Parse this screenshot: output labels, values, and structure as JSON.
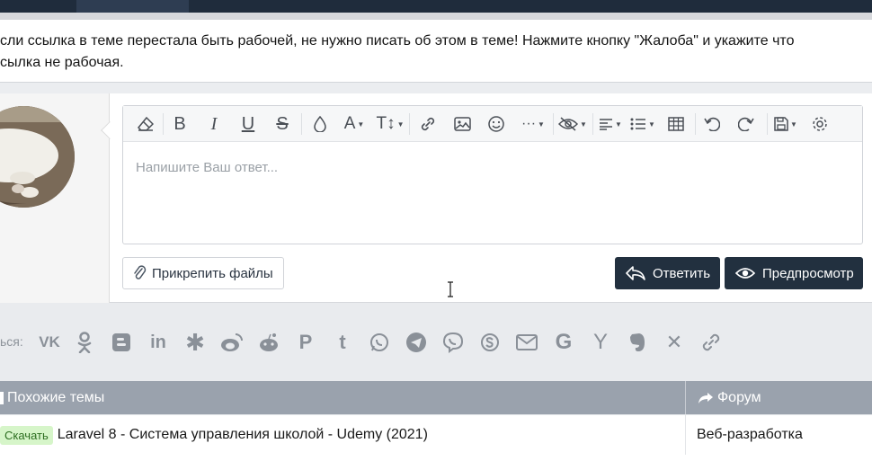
{
  "notice": {
    "text_line1": "сли ссылка в теме перестала быть рабочей, не нужно писать об этом в теме! Нажмите кнопку \"Жалоба\" и укажите что",
    "text_line2": "сылка не рабочая."
  },
  "editor": {
    "placeholder": "Напишите Ваш ответ...",
    "toolbar": [
      {
        "name": "eraser-icon"
      },
      {
        "name": "bold-icon"
      },
      {
        "name": "italic-icon"
      },
      {
        "name": "underline-icon"
      },
      {
        "name": "strike-icon"
      },
      {
        "name": "color-icon"
      },
      {
        "name": "font-family-icon"
      },
      {
        "name": "font-size-icon"
      },
      {
        "name": "link-icon"
      },
      {
        "name": "image-icon"
      },
      {
        "name": "smile-icon"
      },
      {
        "name": "more-icon"
      },
      {
        "name": "hide-icon"
      },
      {
        "name": "align-icon"
      },
      {
        "name": "list-icon"
      },
      {
        "name": "table-icon"
      },
      {
        "name": "undo-icon"
      },
      {
        "name": "redo-icon"
      },
      {
        "name": "save-draft-icon"
      },
      {
        "name": "settings-icon"
      }
    ]
  },
  "actions": {
    "attach_label": "Прикрепить файлы",
    "reply_label": "Ответить",
    "preview_label": "Предпросмотр"
  },
  "share": {
    "label": "ься:",
    "icons": [
      "vk-icon",
      "odnoklassniki-icon",
      "blogger-icon",
      "linkedin-icon",
      "livejournal-icon",
      "weibo-icon",
      "reddit-icon",
      "pinterest-icon",
      "tumblr-icon",
      "whatsapp-icon",
      "telegram-icon",
      "viber-icon",
      "skype-icon",
      "email-icon",
      "google-icon",
      "yandex-icon",
      "evernote-icon",
      "xing-icon",
      "copy-link-icon"
    ]
  },
  "related": {
    "col1_header": "Похожие темы",
    "col2_header": "Форум",
    "rows": [
      {
        "badge": "Скачать",
        "title": "Laravel 8 - Система управления школой - Udemy (2021)",
        "forum": "Веб-разработка"
      }
    ]
  },
  "colors": {
    "topbar": "#1f2c3c",
    "button_dark": "#22303f",
    "table_header": "#9aa2ad",
    "badge_bg": "#d6f5c9"
  }
}
